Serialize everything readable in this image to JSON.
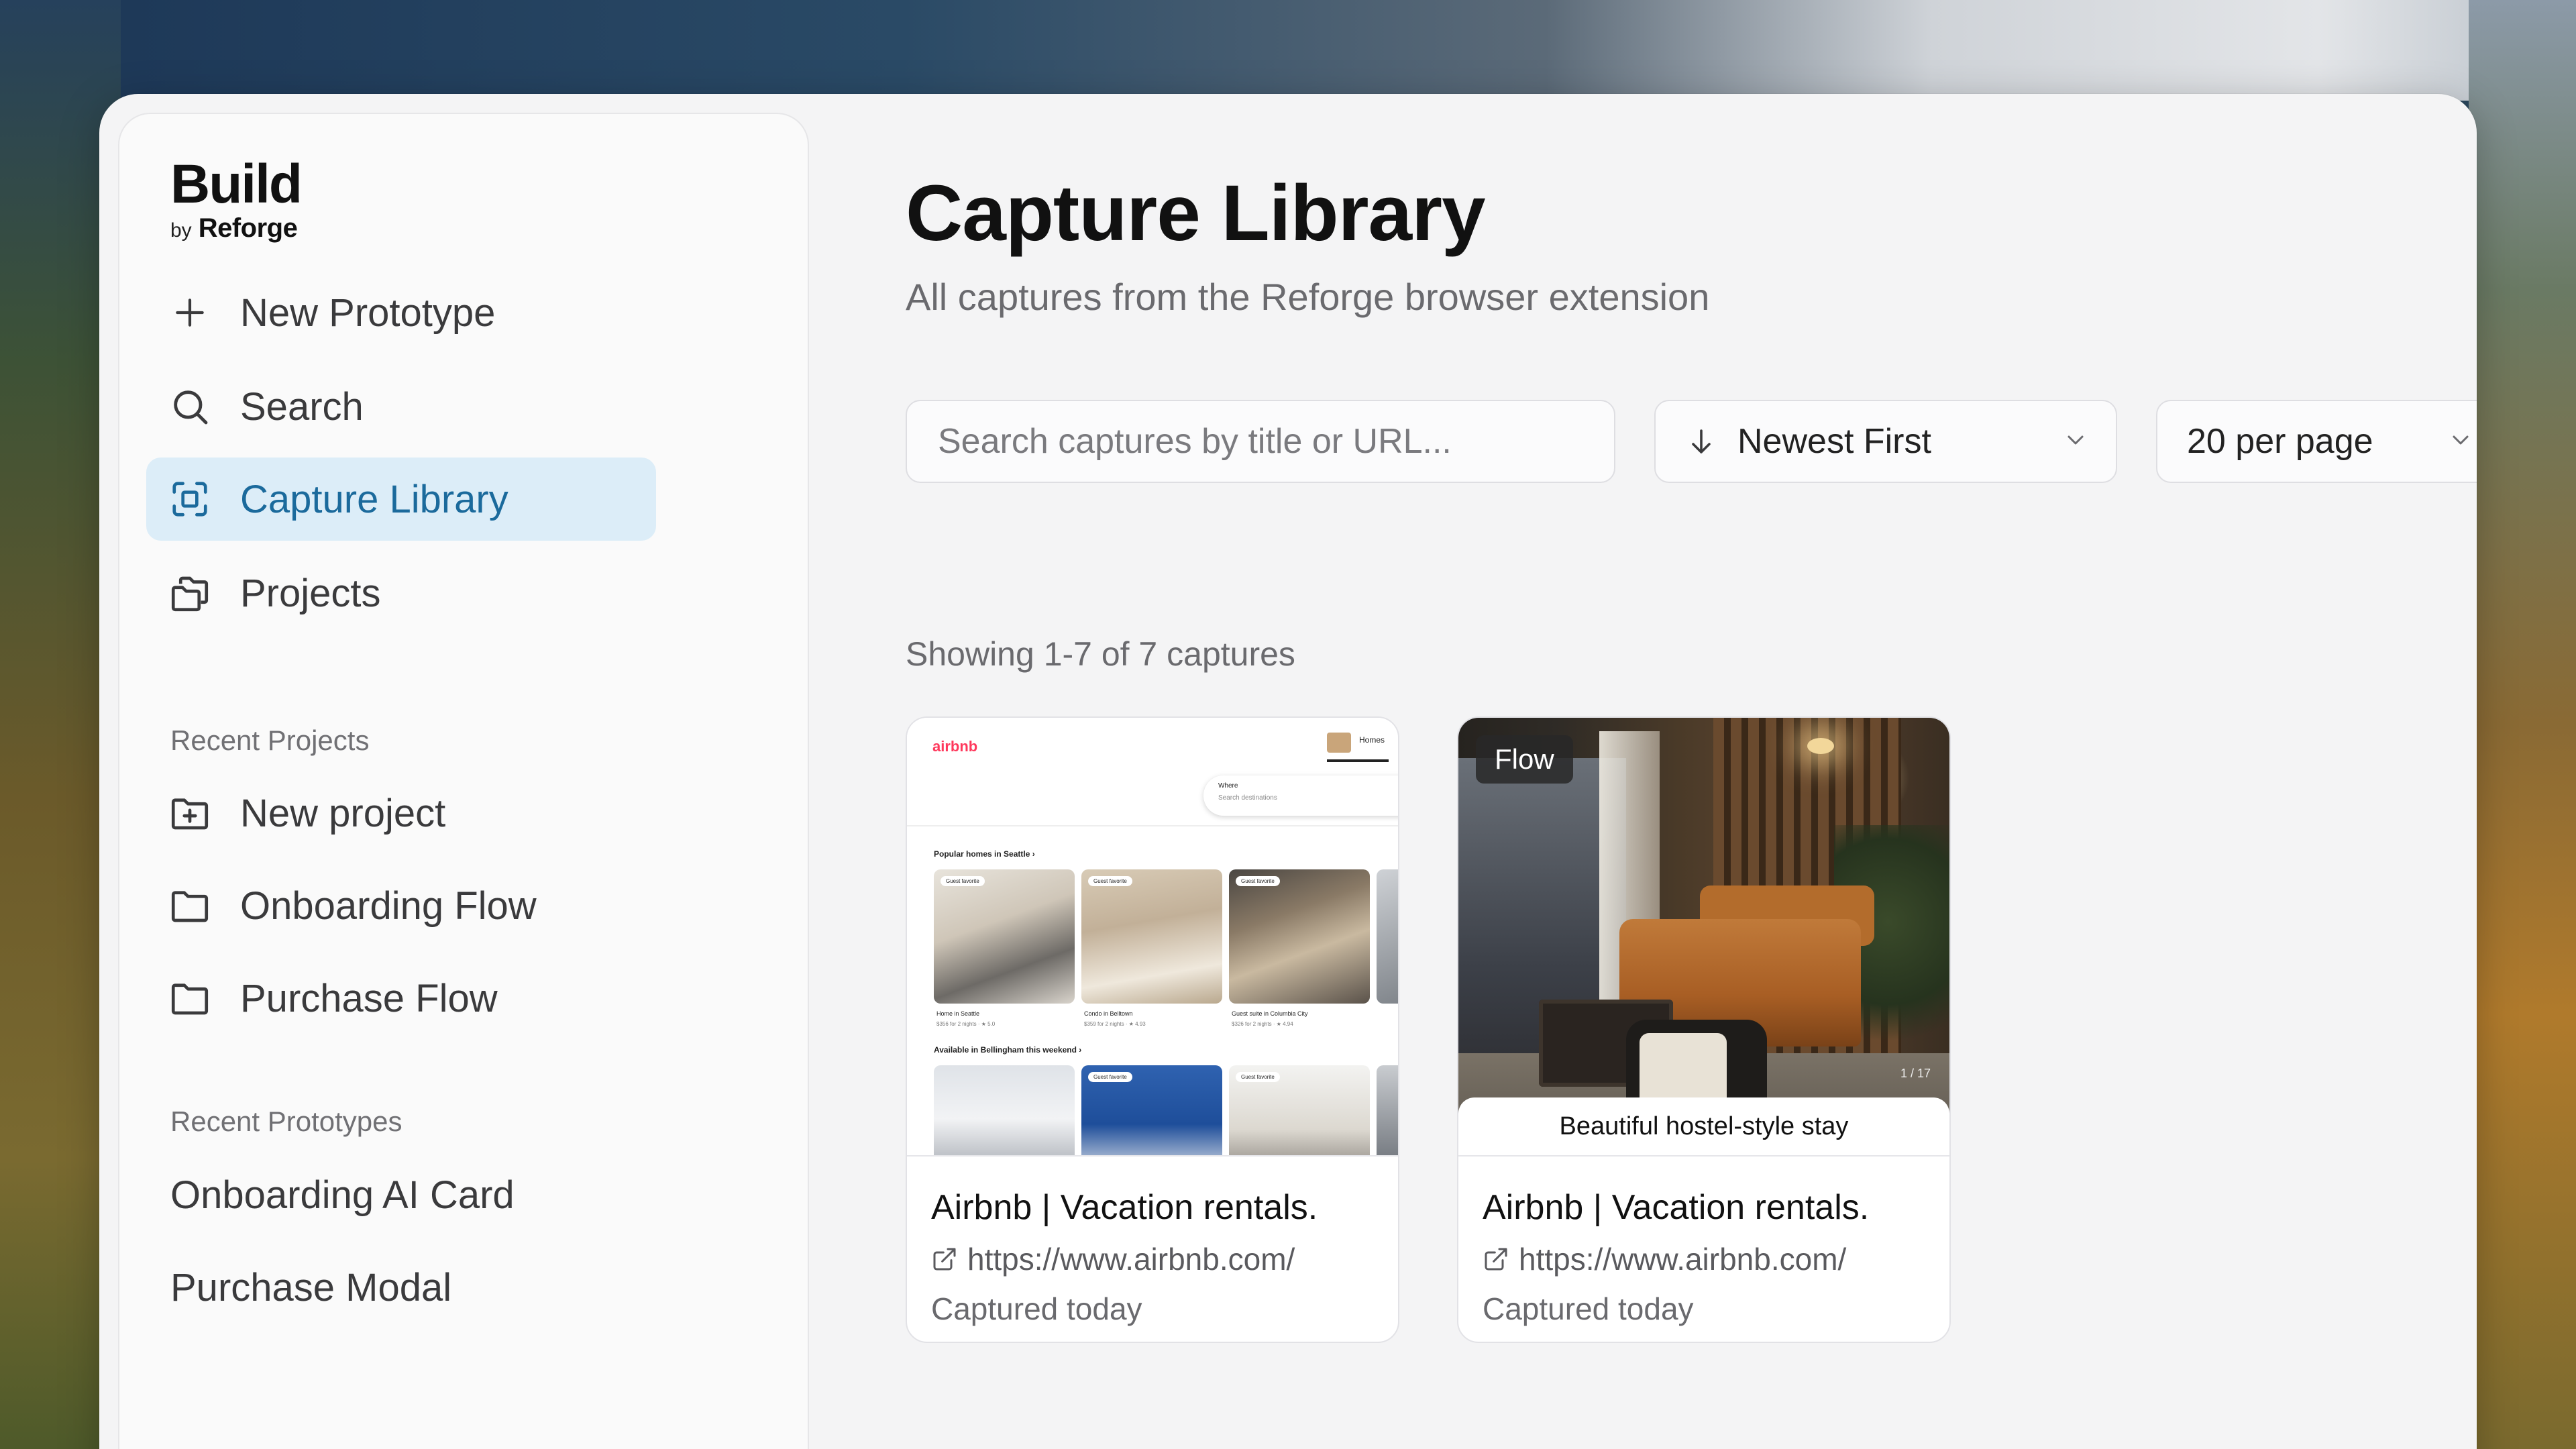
{
  "brand": {
    "title": "Build",
    "by": "by",
    "name": "Reforge"
  },
  "nav": {
    "items": [
      {
        "label": "New Prototype",
        "icon": "plus-icon"
      },
      {
        "label": "Search",
        "icon": "search-icon"
      },
      {
        "label": "Capture Library",
        "icon": "capture-icon",
        "active": true
      },
      {
        "label": "Projects",
        "icon": "projects-icon"
      }
    ]
  },
  "recent_projects": {
    "label": "Recent Projects",
    "items": [
      {
        "label": "New project",
        "icon": "folder-plus-icon"
      },
      {
        "label": "Onboarding Flow",
        "icon": "folder-icon"
      },
      {
        "label": "Purchase Flow",
        "icon": "folder-icon"
      }
    ]
  },
  "recent_prototypes": {
    "label": "Recent Prototypes",
    "items": [
      {
        "label": "Onboarding AI Card"
      },
      {
        "label": "Purchase Modal"
      }
    ]
  },
  "main": {
    "title": "Capture Library",
    "subtitle": "All captures from the Reforge browser extension",
    "search_placeholder": "Search captures by title or URL...",
    "sort_label": "Newest First",
    "per_page_label": "20 per page",
    "count_text": "Showing 1-7 of 7 captures"
  },
  "cards": [
    {
      "title": "Airbnb | Vacation rentals.",
      "url": "https://www.airbnb.com/",
      "captured": "Captured today",
      "thumb": {
        "logo": "airbnb",
        "tab": "Homes",
        "where": "Where",
        "where_hint": "Search destinations",
        "section1": "Popular homes in Seattle ›",
        "section2": "Available in Bellingham this weekend ›",
        "badge": "Guest favorite",
        "tiles": [
          {
            "name": "Home in Seattle",
            "meta": "$356 for 2 nights · ★ 5.0"
          },
          {
            "name": "Condo in Belltown",
            "meta": "$359 for 2 nights · ★ 4.93"
          },
          {
            "name": "Guest suite in Columbia City",
            "meta": "$326 for 2 nights · ★ 4.94"
          }
        ]
      }
    },
    {
      "title": "Airbnb | Vacation rentals.",
      "url": "https://www.airbnb.com/",
      "captured": "Captured today",
      "thumb": {
        "tag": "Flow",
        "counter": "1 / 17",
        "caption": "Beautiful hostel-style stay"
      }
    }
  ],
  "colors": {
    "active_bg": "#dcedf8",
    "active_text": "#1b6a9c",
    "airbnb": "#ff385c"
  }
}
